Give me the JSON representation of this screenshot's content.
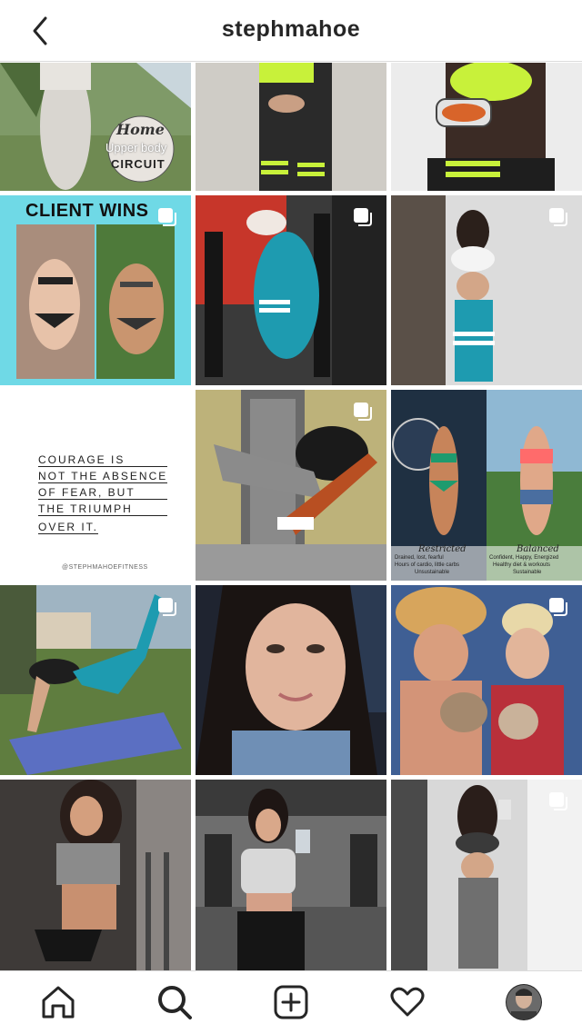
{
  "header": {
    "username": "stephmahoe"
  },
  "tiles": {
    "t1": {
      "label_line1": "Home",
      "label_line2": "Upper body",
      "label_line3": "CIRCUIT"
    },
    "t4": {
      "headline": "CLIENT WINS"
    },
    "t7": {
      "quote_lines": [
        "COURAGE IS",
        "NOT THE ABSENCE",
        "OF FEAR, BUT",
        "THE TRIUMPH",
        "OVER IT."
      ],
      "handle": "@STEPHMAHOEFITNESS"
    },
    "t9": {
      "left_caption": "Restricted",
      "left_sub_1": "Drained, lost, fearful",
      "left_sub_2": "Hours of cardio, little carbs",
      "left_sub_3": "Unsustainable",
      "right_caption": "Balanced",
      "right_sub_1": "Confident, Happy, Energized",
      "right_sub_2": "Healthy diet & workouts",
      "right_sub_3": "Sustainable"
    }
  },
  "icons": {
    "back": "chevron-left-icon",
    "multi": "multiple-posts-icon",
    "home": "home-icon",
    "search": "search-icon",
    "add": "add-post-icon",
    "activity": "heart-icon",
    "profile": "profile-avatar"
  },
  "colors": {
    "accent_text": "#262626",
    "divider": "#dbdbdb",
    "teal": "#1e9bb0",
    "neon": "#c8f13a"
  }
}
